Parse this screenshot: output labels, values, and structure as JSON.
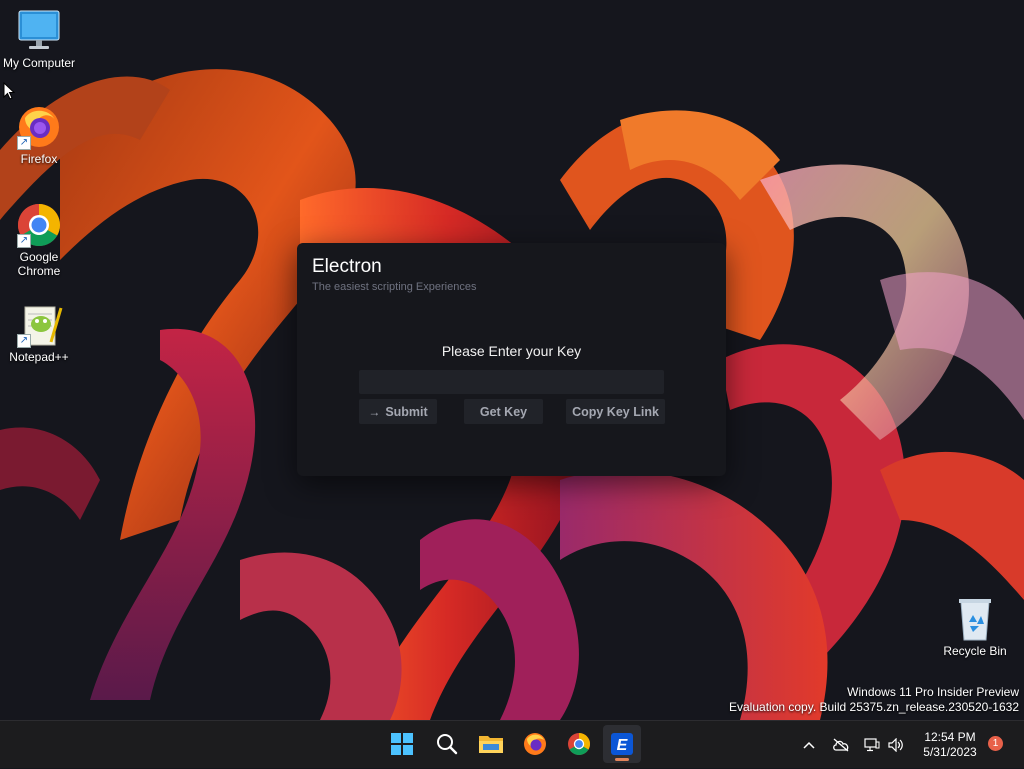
{
  "desktop": {
    "icons": [
      {
        "label": "My Computer",
        "icon": "monitor-icon"
      },
      {
        "label": "Firefox",
        "icon": "firefox-icon"
      },
      {
        "label": "Google Chrome",
        "icon": "chrome-icon"
      },
      {
        "label": "Notepad++",
        "icon": "notepad-plus-plus-icon"
      },
      {
        "label": "Recycle Bin",
        "icon": "recycle-bin-icon"
      }
    ]
  },
  "electron_window": {
    "title": "Electron",
    "subtitle": "The easiest scripting Experiences",
    "heading": "Please Enter your Key",
    "key_input": {
      "value": "",
      "placeholder": ""
    },
    "buttons": {
      "submit": "Submit",
      "get_key": "Get Key",
      "copy_key_link": "Copy Key Link"
    }
  },
  "watermark": {
    "line1": "Windows 11 Pro Insider Preview",
    "line2": "Evaluation copy. Build 25375.zn_release.230520-1632"
  },
  "taskbar": {
    "apps": [
      "start-icon",
      "search-icon",
      "file-explorer-icon",
      "firefox-icon",
      "chrome-icon",
      "electron-icon"
    ],
    "active_app": "electron-icon",
    "clock": {
      "time": "12:54 PM",
      "date": "5/31/2023"
    },
    "notification_count": "1"
  },
  "colors": {
    "window_bg": "#16171c",
    "button_bg": "#212329",
    "taskbar_bg": "#1c1c1e",
    "accent": "#e2845a"
  }
}
